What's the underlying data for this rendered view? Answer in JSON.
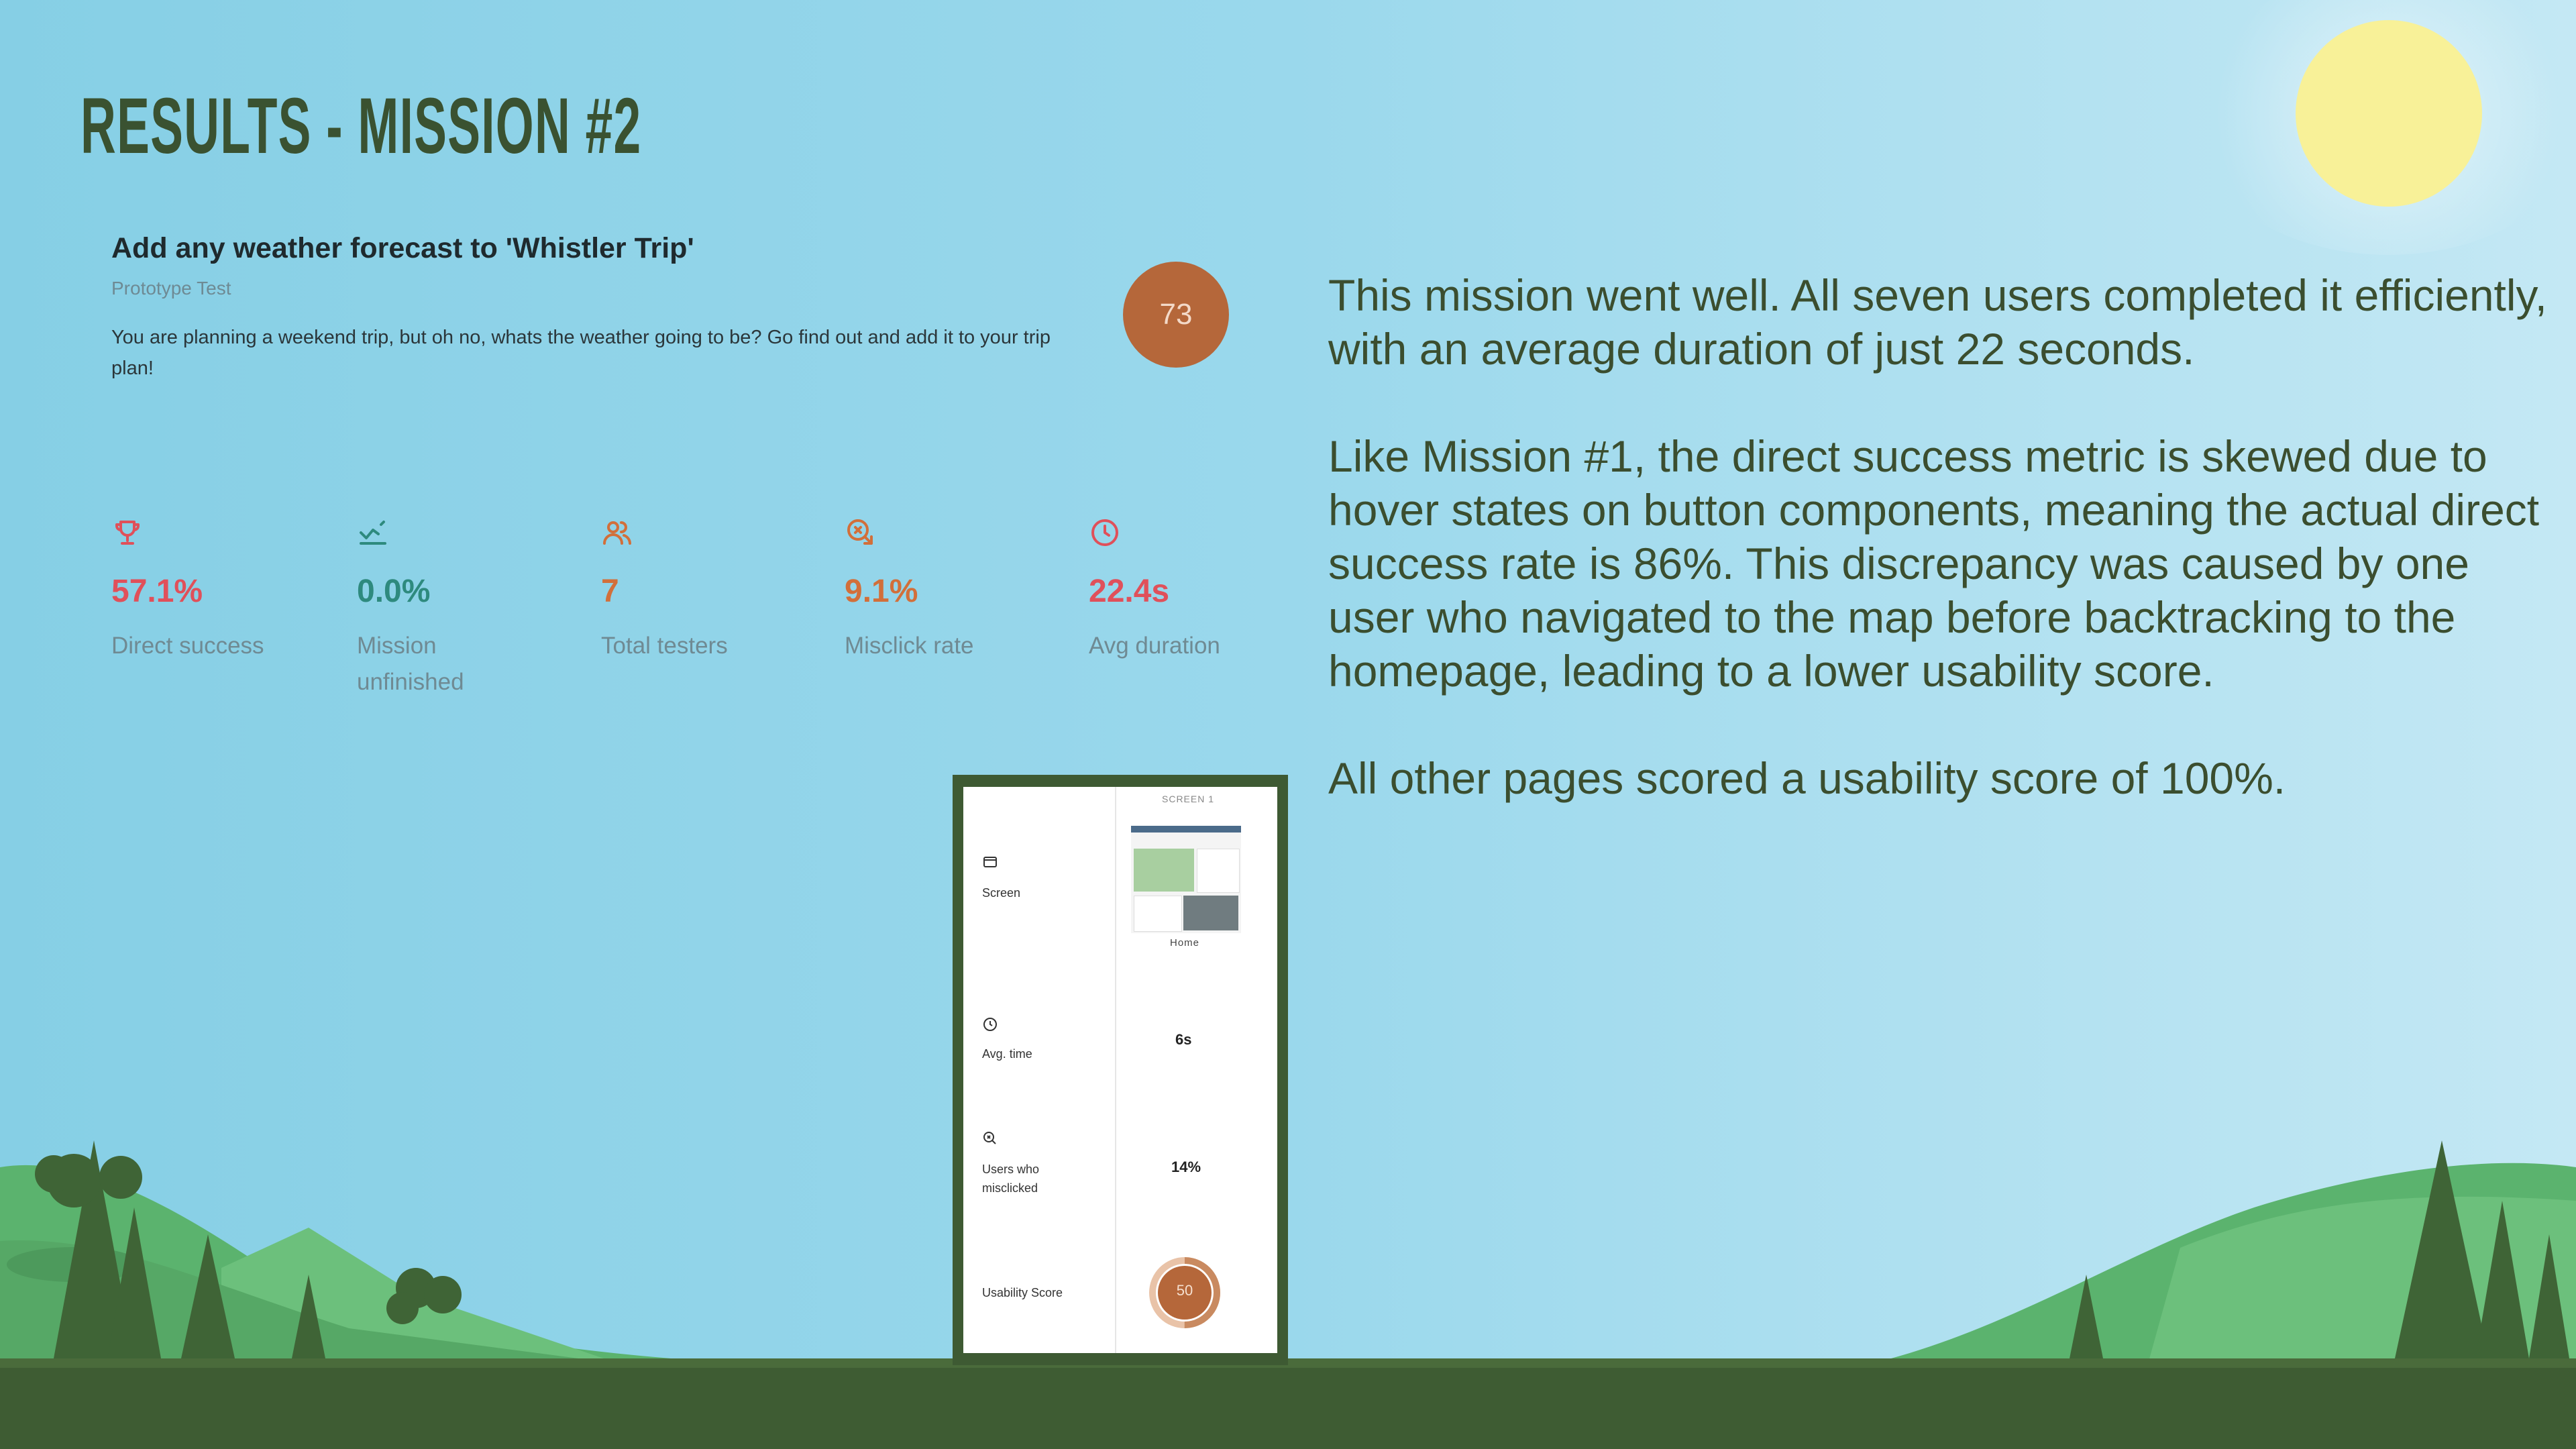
{
  "slide": {
    "title": "RESULTS - MISSION #2"
  },
  "mission": {
    "title": "Add any weather forecast to 'Whistler Trip'",
    "type": "Prototype Test",
    "description": "You are planning a weekend trip, but oh no, whats the weather going to be? Go find out and add it to your trip plan!",
    "score": "73"
  },
  "stats": [
    {
      "icon": "trophy-icon",
      "value": "57.1%",
      "label": "Direct success",
      "color": "#e0505a"
    },
    {
      "icon": "mission-unfinished-icon",
      "value": "0.0%",
      "label": "Mission unfinished",
      "color": "#2e8a7e"
    },
    {
      "icon": "testers-icon",
      "value": "7",
      "label": "Total testers",
      "color": "#d26f3a"
    },
    {
      "icon": "misclick-icon",
      "value": "9.1%",
      "label": "Misclick rate",
      "color": "#d26f3a"
    },
    {
      "icon": "clock-icon",
      "value": "22.4s",
      "label": "Avg duration",
      "color": "#e0505a"
    }
  ],
  "summary": {
    "p1": "This mission went well. All seven users completed it efficiently, with an average duration of just 22 seconds.",
    "p2": "Like Mission #1, the direct success metric is skewed due to hover states on button components, meaning the actual direct success rate is 86%. This discrepancy was caused by one user who navigated to the map before backtracking to the homepage, leading to a lower usability score.",
    "p3": "All other pages scored a usability score of 100%."
  },
  "screen_card": {
    "header": "SCREEN 1",
    "screen_label": "Screen",
    "screen_name": "Home",
    "avg_time_label": "Avg. time",
    "avg_time_value": "6s",
    "misclick_label": "Users who misclicked",
    "misclick_value": "14%",
    "usability_label": "Usability Score",
    "usability_value": "50",
    "usability_fraction": 0.5
  },
  "colors": {
    "title": "#3a5231",
    "score_circle": "#b5673a",
    "body_text": "#3b4e2f",
    "ground": "#3e5c33"
  }
}
